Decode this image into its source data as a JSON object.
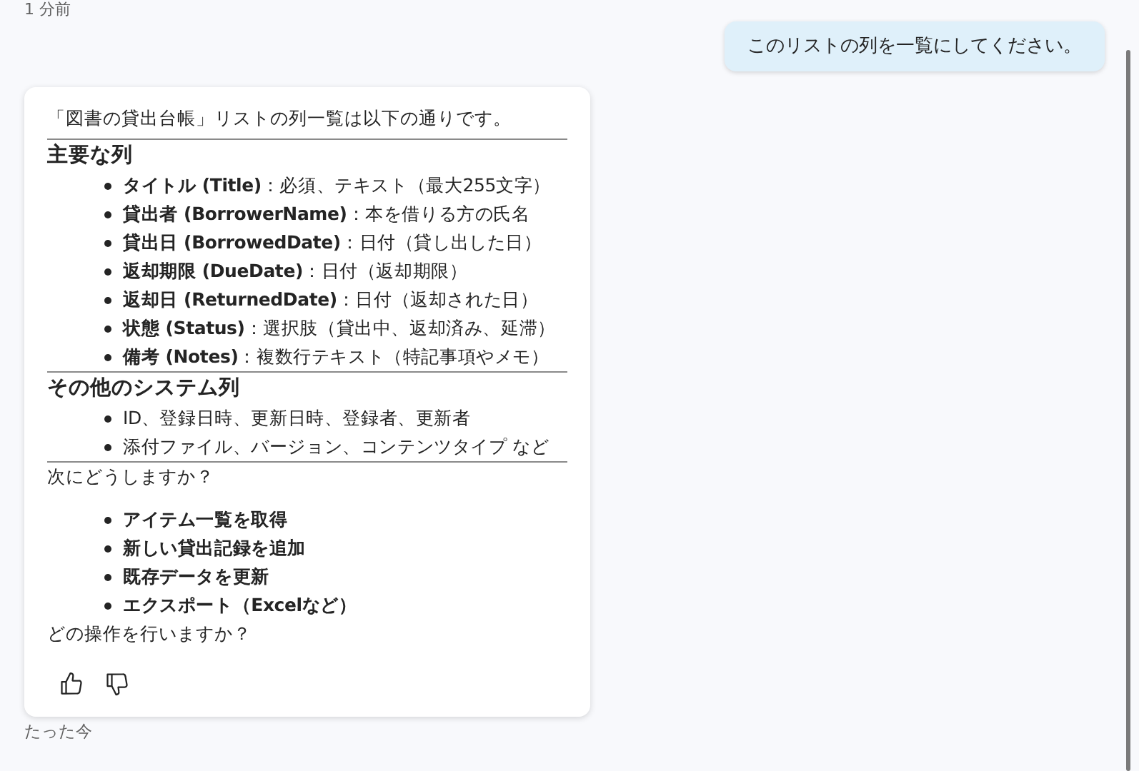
{
  "previous_timestamp": "1 分前",
  "user_message": {
    "text": "このリストの列を一覧にしてください。"
  },
  "assistant_message": {
    "intro": "「図書の貸出台帳」リストの列一覧は以下の通りです。",
    "sections": [
      {
        "heading": "主要な列",
        "items": [
          "**タイトル (Title)**：必須、テキスト（最大255文字）",
          "**貸出者 (BorrowerName)**：本を借りる方の氏名",
          "**貸出日 (BorrowedDate)**：日付（貸し出した日）",
          "**返却期限 (DueDate)**：日付（返却期限）",
          "**返却日 (ReturnedDate)**：日付（返却された日）",
          "**状態 (Status)**：選択肢（貸出中、返却済み、延滞）",
          "**備考 (Notes)**：複数行テキスト（特記事項やメモ）"
        ]
      },
      {
        "heading": "その他のシステム列",
        "items": [
          "ID、登録日時、更新日時、登録者、更新者",
          "添付ファイル、バージョン、コンテンツタイプ など"
        ]
      }
    ],
    "question": "次にどうしますか？",
    "actions": [
      "アイテム一覧を取得",
      "新しい貸出記録を追加",
      "既存データを更新",
      "エクスポート（Excelなど）"
    ],
    "closing": "どの操作を行いますか？",
    "timestamp": "たった今"
  }
}
